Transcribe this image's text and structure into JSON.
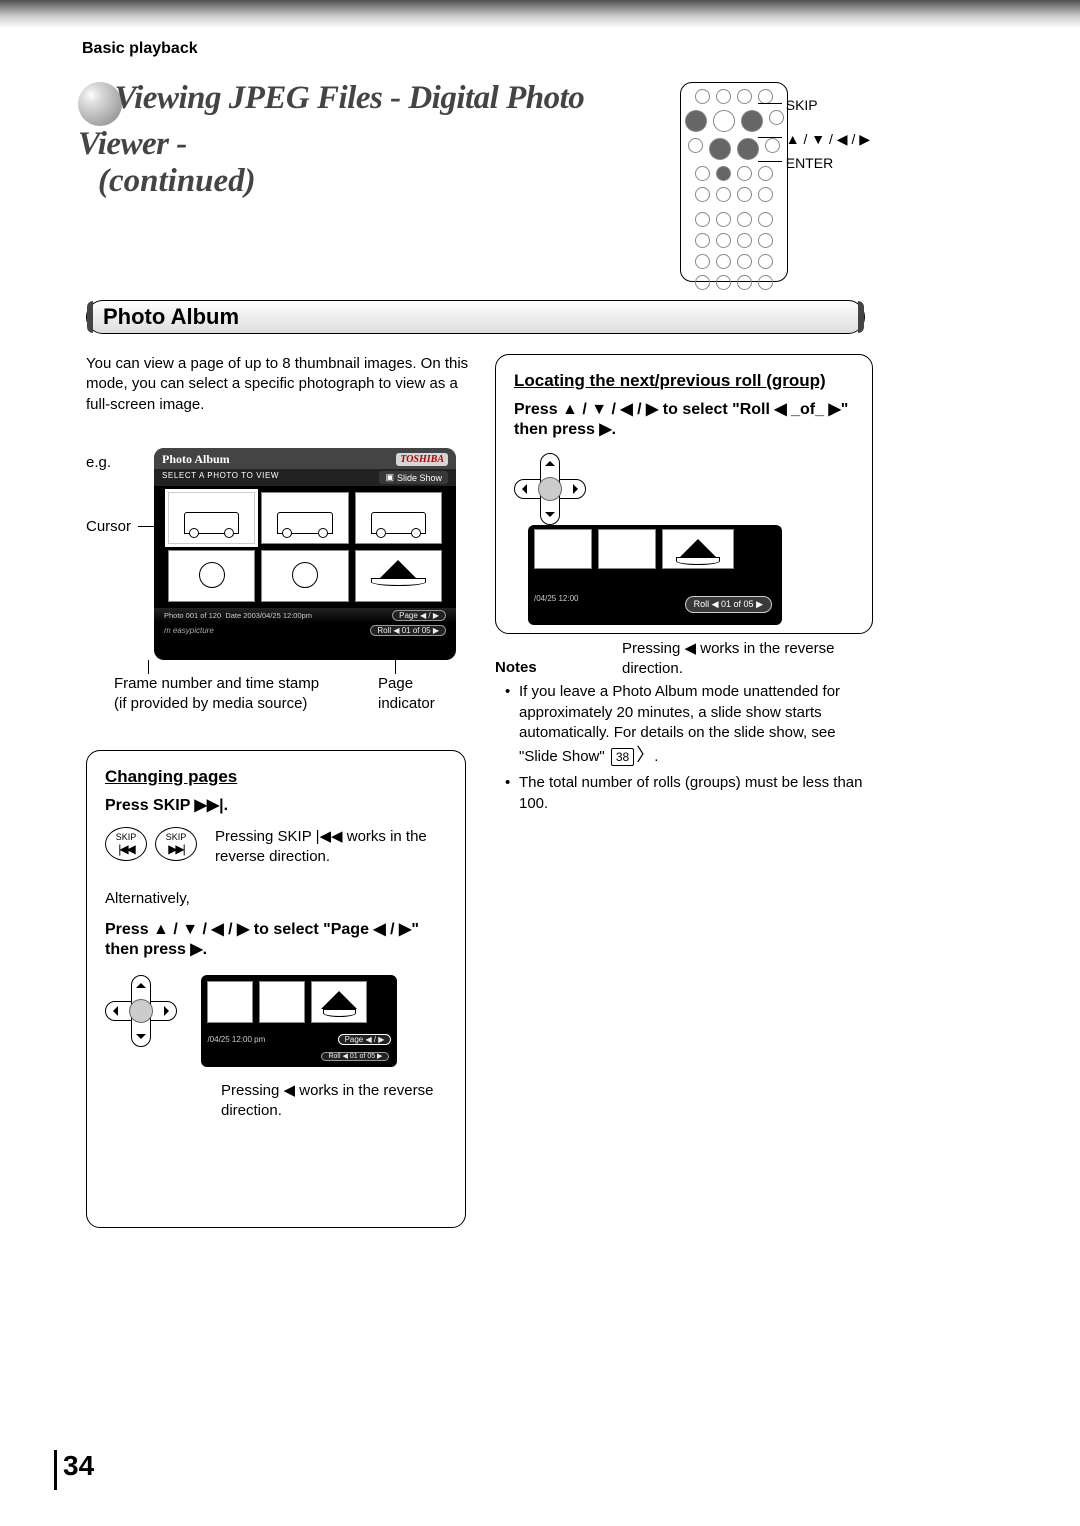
{
  "section_label": "Basic playback",
  "title_l1": "Viewing JPEG Files - Digital Photo Viewer -",
  "title_l2": "(continued)",
  "remote_labels": {
    "skip": "SKIP",
    "arrows": "▲ / ▼ / ◀ / ▶",
    "enter": "ENTER"
  },
  "section_heading": "Photo Album",
  "intro": "You can view a page of up to 8 thumbnail images. On this mode, you can select a specific photograph to view as a full-screen image.",
  "eg": "e.g.",
  "cursor_label": "Cursor",
  "album_ui": {
    "header_left": "Photo Album",
    "header_right": "TOSHIBA",
    "subheader_left": "SELECT A PHOTO TO VIEW",
    "subheader_right": "Slide Show",
    "footer_photo": "Photo 001 of 120",
    "footer_date": "Date 2003/04/25 12:00pm",
    "footer_page": "Page ◀ / ▶",
    "footer2_left": "m easypicture",
    "footer_roll": "Roll ◀ 01 of 05 ▶"
  },
  "annot_left_1": "Frame number and time stamp",
  "annot_left_2": "(if provided by media source)",
  "annot_right": "Page indicator",
  "changing": {
    "heading": "Changing pages",
    "press_skip": "Press SKIP ▶▶|.",
    "skip_btn": "SKIP",
    "skip_sym_prev": "|◀◀",
    "skip_sym_next": "▶▶|",
    "skip_note": "Pressing SKIP |◀◀ works in the reverse direction.",
    "alt": "Alternatively,",
    "press_arrows": "Press ▲ / ▼ / ◀ / ▶ to select \"Page ◀ / ▶\" then press ▶.",
    "mini_bar_date": "/04/25 12:00 pm",
    "mini_page_chip": "Page ◀ / ▶",
    "mini_roll_chip": "Roll ◀ 01 of 05 ▶",
    "reverse_note": "Pressing ◀ works in the reverse direction."
  },
  "locating": {
    "heading": "Locating the next/previous roll (group)",
    "press_line": "Press ▲ / ▼ / ◀ / ▶ to select \"Roll ◀ _of_ ▶\" then press ▶.",
    "mini_bar_date": "/04/25 12:00",
    "mini_roll_chip": "Roll ◀ 01 of 05 ▶",
    "reverse_note": "Pressing ◀ works in the reverse direction."
  },
  "notes": {
    "heading": "Notes",
    "n1a": "If you leave a Photo Album mode unattended for approximately 20 minutes, a slide show starts automatically.  For details on the slide show, see \"Slide Show\" ",
    "n1_ref": "38",
    "n1b": ".",
    "n2": "The total number of rolls (groups) must be less than 100."
  },
  "page_number": "34"
}
